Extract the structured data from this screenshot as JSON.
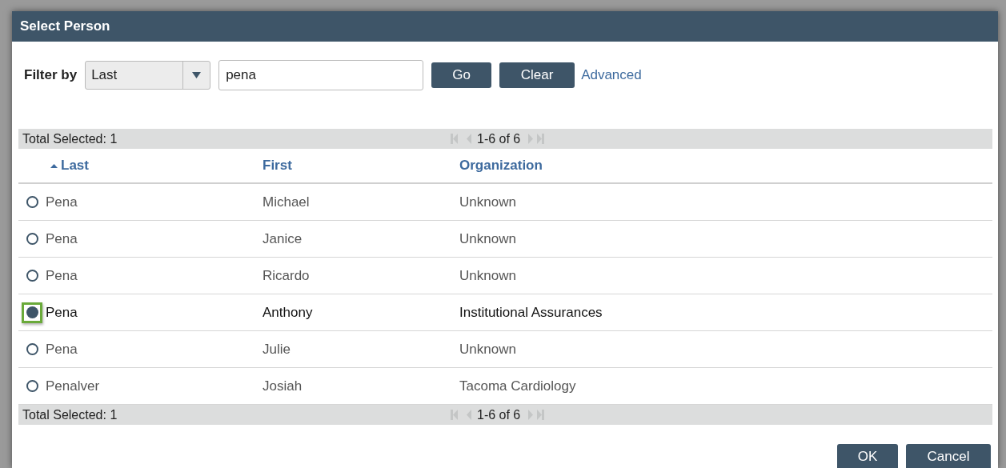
{
  "window": {
    "title": "Select Person"
  },
  "filter": {
    "label": "Filter by",
    "field": "Last",
    "query": "pena",
    "buttons": [
      "Go",
      "Clear"
    ],
    "link": "Advanced"
  },
  "top_pager": {
    "total": "Total Selected: 1",
    "range": "1-6 of 6"
  },
  "table": {
    "columns": [
      {
        "label": "Last",
        "sorted": true
      },
      {
        "label": "First",
        "sorted": false
      },
      {
        "label": "Organization",
        "sorted": false
      }
    ],
    "rows": [
      {
        "cells": [
          "Pena",
          "Michael",
          "Unknown"
        ],
        "selected": false
      },
      {
        "cells": [
          "Pena",
          "Janice",
          "Unknown"
        ],
        "selected": false
      },
      {
        "cells": [
          "Pena",
          "Ricardo",
          "Unknown"
        ],
        "selected": false
      },
      {
        "cells": [
          "Pena",
          "Anthony",
          "Institutional Assurances"
        ],
        "selected": true
      },
      {
        "cells": [
          "Pena",
          "Julie",
          "Unknown"
        ],
        "selected": false
      },
      {
        "cells": [
          "Penalver",
          "Josiah",
          "Tacoma Cardiology"
        ],
        "selected": false
      }
    ]
  },
  "bottom_pager": {
    "total": "Total Selected: 1",
    "range": "1-6 of 6"
  },
  "buttons": [
    "OK",
    "Cancel"
  ]
}
